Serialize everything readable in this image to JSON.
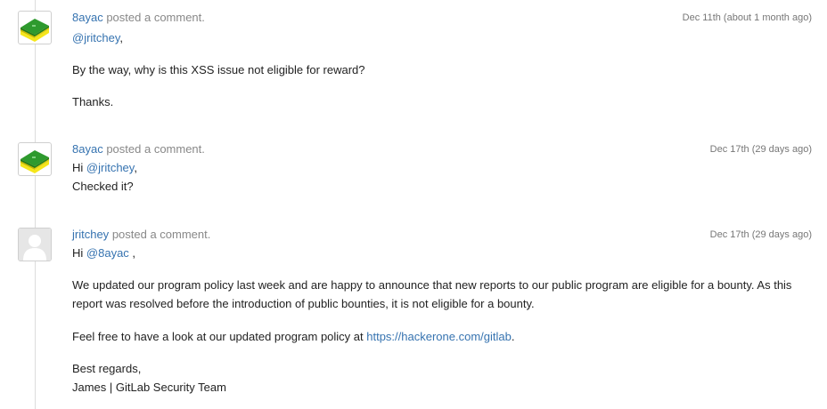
{
  "colors": {
    "link": "#3673b0",
    "meta_text": "#888888",
    "timeline": "#dcdcdc",
    "avatar_green": "#2e9a2e",
    "avatar_yellow": "#f5e61a"
  },
  "comments": [
    {
      "user": "8ayac",
      "action": "posted a comment.",
      "timestamp": "Dec 11th (about 1 month ago)",
      "avatar_icon": "green-yellow-block-avatar-icon",
      "mention": "@jritchey",
      "mention_suffix": ",",
      "line_1": "By the way, why is this XSS issue not eligible for reward?",
      "line_2": "Thanks."
    },
    {
      "user": "8ayac",
      "action": "posted a comment.",
      "timestamp": "Dec 17th (29 days ago)",
      "avatar_icon": "green-yellow-block-avatar-icon",
      "greeting": "Hi",
      "mention": "@jritchey",
      "mention_suffix": ",",
      "line_2": "Checked it?"
    },
    {
      "user": "jritchey",
      "action": "posted a comment.",
      "timestamp": "Dec 17th (29 days ago)",
      "avatar_icon": "default-user-avatar-icon",
      "greeting": "Hi",
      "mention": "@8ayac",
      "mention_suffix": " ,",
      "paragraph_1": "We updated our program policy last week and are happy to announce that new reports to our public program are eligible for a bounty. As this report was resolved before the introduction of public bounties, it is not eligible for a bounty.",
      "paragraph_2_prefix": "Feel free to have a look at our updated program policy at ",
      "paragraph_2_link": "https://hackerone.com/gitlab",
      "paragraph_2_suffix": ".",
      "signoff_1": "Best regards,",
      "signoff_2": "James | GitLab Security Team"
    }
  ]
}
